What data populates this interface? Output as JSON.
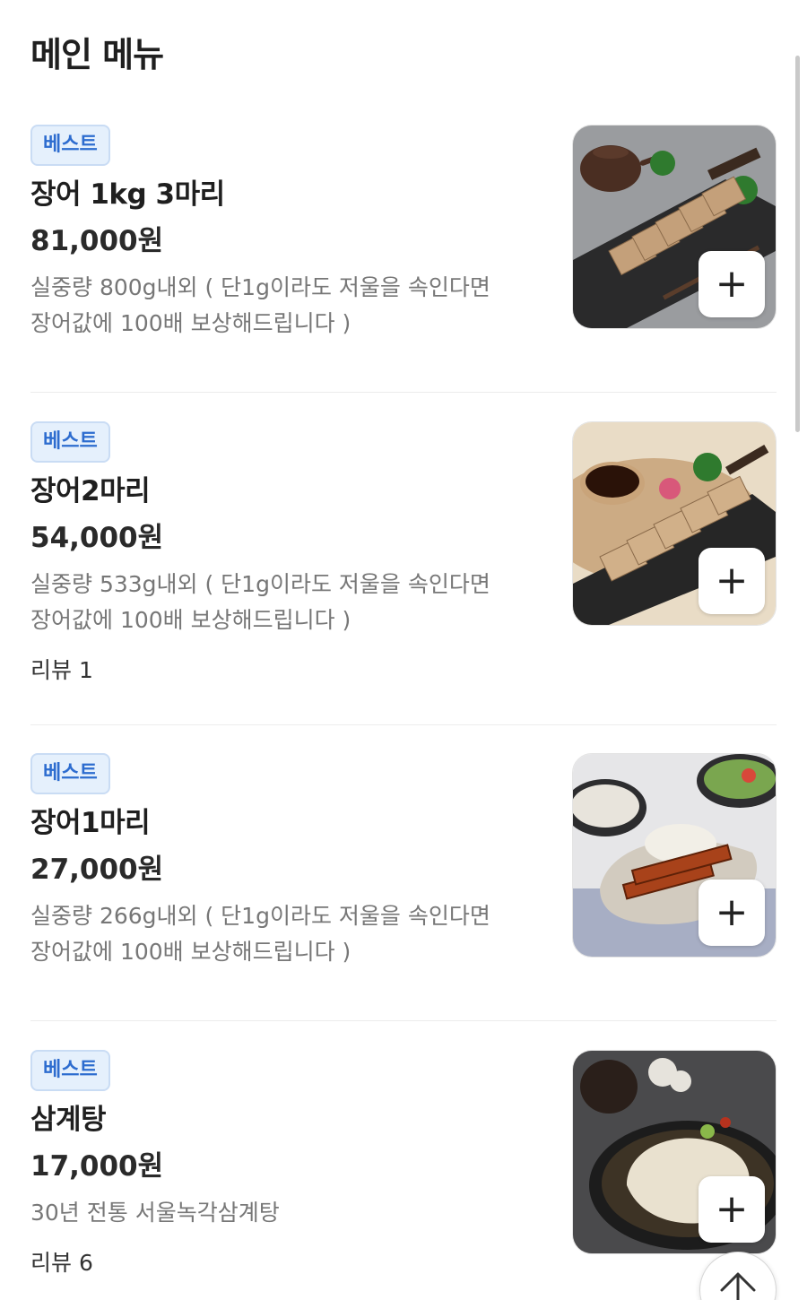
{
  "section": {
    "title": "메인 메뉴"
  },
  "items": [
    {
      "badge": "베스트",
      "name": "장어 1kg 3마리",
      "price": "81,000원",
      "description": "실중량 800g내외 ( 단1g이라도 저울을 속인다면\n장어값에 100배 보상해드립니다 )",
      "review": "",
      "add_label": "+",
      "image": "grilled-eel-platter-with-teapot"
    },
    {
      "badge": "베스트",
      "name": "장어2마리",
      "price": "54,000원",
      "description": "실중량 533g내외 ( 단1g이라도 저울을 속인다면\n장어값에 100배 보상해드립니다 )",
      "review": "리뷰 1",
      "add_label": "+",
      "image": "grilled-eel-with-dipping-sauce"
    },
    {
      "badge": "베스트",
      "name": "장어1마리",
      "price": "27,000원",
      "description": "실중량 266g내외 ( 단1g이라도 저울을 속인다면\n장어값에 100배 보상해드립니다 )",
      "review": "",
      "add_label": "+",
      "image": "glazed-eel-with-salad-bowls"
    },
    {
      "badge": "베스트",
      "name": "삼계탕",
      "price": "17,000원",
      "description": "30년 전통 서울녹각삼계탕",
      "review": "리뷰 6",
      "add_label": "+",
      "image": "samgyetang-chicken-soup"
    }
  ],
  "icons": {
    "add": "plus-icon",
    "scroll_top": "arrow-up-icon"
  },
  "colors": {
    "badge_bg": "#e5f0fc",
    "badge_text": "#2d6ccf",
    "divider": "#ececec"
  }
}
